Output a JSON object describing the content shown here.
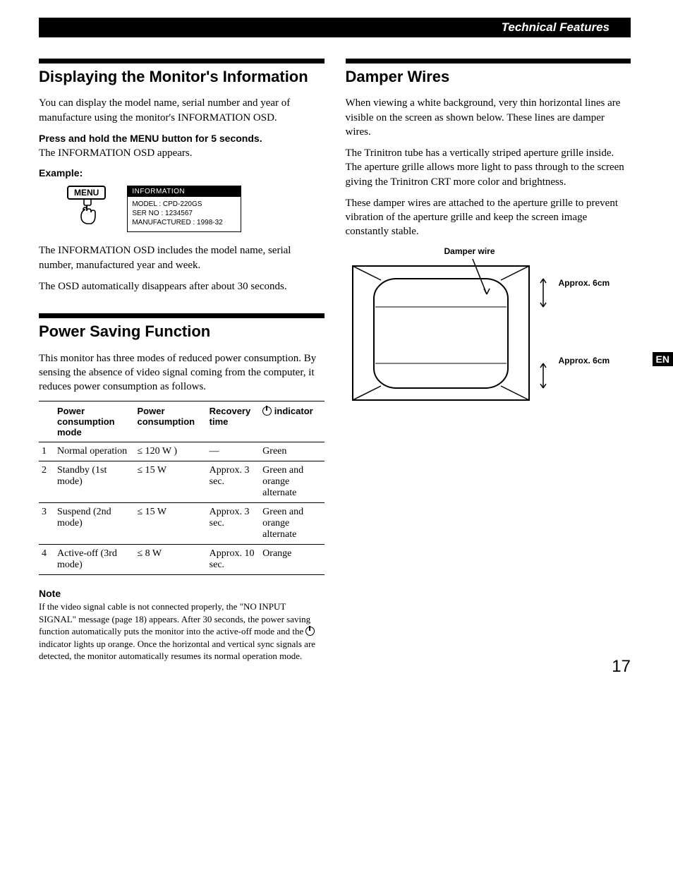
{
  "header": {
    "title": "Technical Features"
  },
  "left": {
    "sec1": {
      "title": "Displaying the Monitor's Information",
      "p1": "You can display the model name, serial number and year of manufacture using the monitor's INFORMATION OSD.",
      "p2a": "Press and hold the MENU button for 5 seconds.",
      "p2b": "The INFORMATION OSD appears.",
      "example_label": "Example:",
      "menu_btn": "MENU",
      "osd_header": "INFORMATION",
      "osd_l1": "MODEL : CPD-220GS",
      "osd_l2": "SER NO : 1234567",
      "osd_l3": "MANUFACTURED : 1998-32",
      "p3": "The INFORMATION OSD includes the model name, serial number, manufactured year and week.",
      "p4": "The OSD automatically disappears after about 30 seconds."
    },
    "sec2": {
      "title": "Power Saving Function",
      "p1": "This monitor has three modes of reduced power consumption. By sensing the absence of video signal coming from the computer, it reduces power consumption as follows.",
      "table": {
        "headers": [
          "",
          "Power consumption mode",
          "Power consumption",
          "Recovery time",
          "indicator"
        ],
        "rows": [
          [
            "1",
            "Normal operation",
            "≤ 120 W )",
            "—",
            "Green"
          ],
          [
            "2",
            "Standby (1st mode)",
            "≤ 15 W",
            "Approx. 3 sec.",
            "Green and orange alternate"
          ],
          [
            "3",
            "Suspend (2nd mode)",
            "≤ 15 W",
            "Approx. 3 sec.",
            "Green and orange alternate"
          ],
          [
            "4",
            "Active-off (3rd mode)",
            "≤ 8 W",
            "Approx. 10 sec.",
            "Orange"
          ]
        ]
      },
      "note_title": "Note",
      "note_body": "If the video signal cable is not connected properly, the \"NO INPUT SIGNAL\" message (page 18) appears. After 30 seconds, the power saving function automatically puts the monitor into the active-off mode and the ",
      "note_body2": " indicator lights up orange. Once the horizontal and vertical sync signals are detected, the monitor automatically resumes its normal operation mode."
    }
  },
  "right": {
    "sec1": {
      "title": "Damper Wires",
      "p1": "When viewing a white background, very thin horizontal lines are visible on the screen as shown below. These lines are damper wires.",
      "p2": "The Trinitron tube has a vertically striped aperture grille inside. The aperture grille allows more light to pass through to the screen giving the Trinitron CRT more color and brightness.",
      "p3": "These damper wires are attached to the aperture grille to prevent vibration of the aperture grille and keep the screen image constantly stable.",
      "fig": {
        "damper_label": "Damper wire",
        "approx1": "Approx. 6cm",
        "approx2": "Approx. 6cm",
        "en": "EN"
      }
    }
  },
  "page_number": "17"
}
